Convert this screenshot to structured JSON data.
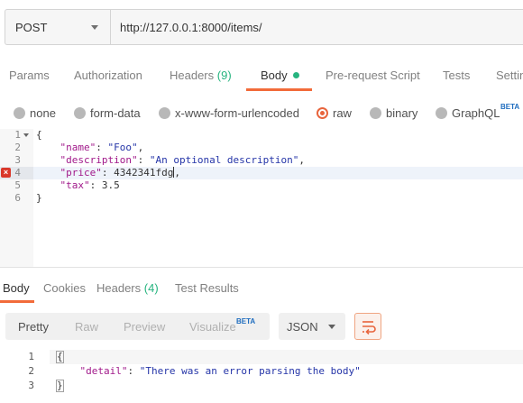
{
  "request": {
    "method": "POST",
    "url": "http://127.0.0.1:8000/items/"
  },
  "request_tabs": {
    "params": "Params",
    "authorization": "Authorization",
    "headers": "Headers",
    "headers_count": "(9)",
    "body": "Body",
    "prerequest": "Pre-request Script",
    "tests": "Tests",
    "settings": "Settin"
  },
  "body_types": {
    "none": "none",
    "form_data": "form-data",
    "urlencoded": "x-www-form-urlencoded",
    "raw": "raw",
    "binary": "binary",
    "graphql": "GraphQL",
    "graphql_badge": "BETA",
    "selected": "raw"
  },
  "editor": {
    "line_numbers": [
      "1",
      "2",
      "3",
      "4",
      "5",
      "6"
    ],
    "error_marker": "×",
    "line1": "{",
    "line2_key": "\"name\"",
    "line2_val": "\"Foo\"",
    "line3_key": "\"description\"",
    "line3_val": "\"An optional description\"",
    "line4_key": "\"price\"",
    "line4_val": "4342341fdg",
    "line5_key": "\"tax\"",
    "line5_val": "3.5",
    "line6": "}"
  },
  "response_tabs": {
    "body": "Body",
    "cookies": "Cookies",
    "headers": "Headers",
    "headers_count": "(4)",
    "test_results": "Test Results"
  },
  "response_toolbar": {
    "pretty": "Pretty",
    "raw": "Raw",
    "preview": "Preview",
    "visualize": "Visualize",
    "visualize_badge": "BETA",
    "format": "JSON"
  },
  "response_body": {
    "line_numbers": [
      "1",
      "2",
      "3"
    ],
    "line1": "{",
    "line2_key": "\"detail\"",
    "line2_val": "\"There was an error parsing the body\"",
    "line3": "}"
  },
  "colors": {
    "accent": "#f26b3a",
    "success": "#26b47f",
    "error": "#d9372a"
  }
}
